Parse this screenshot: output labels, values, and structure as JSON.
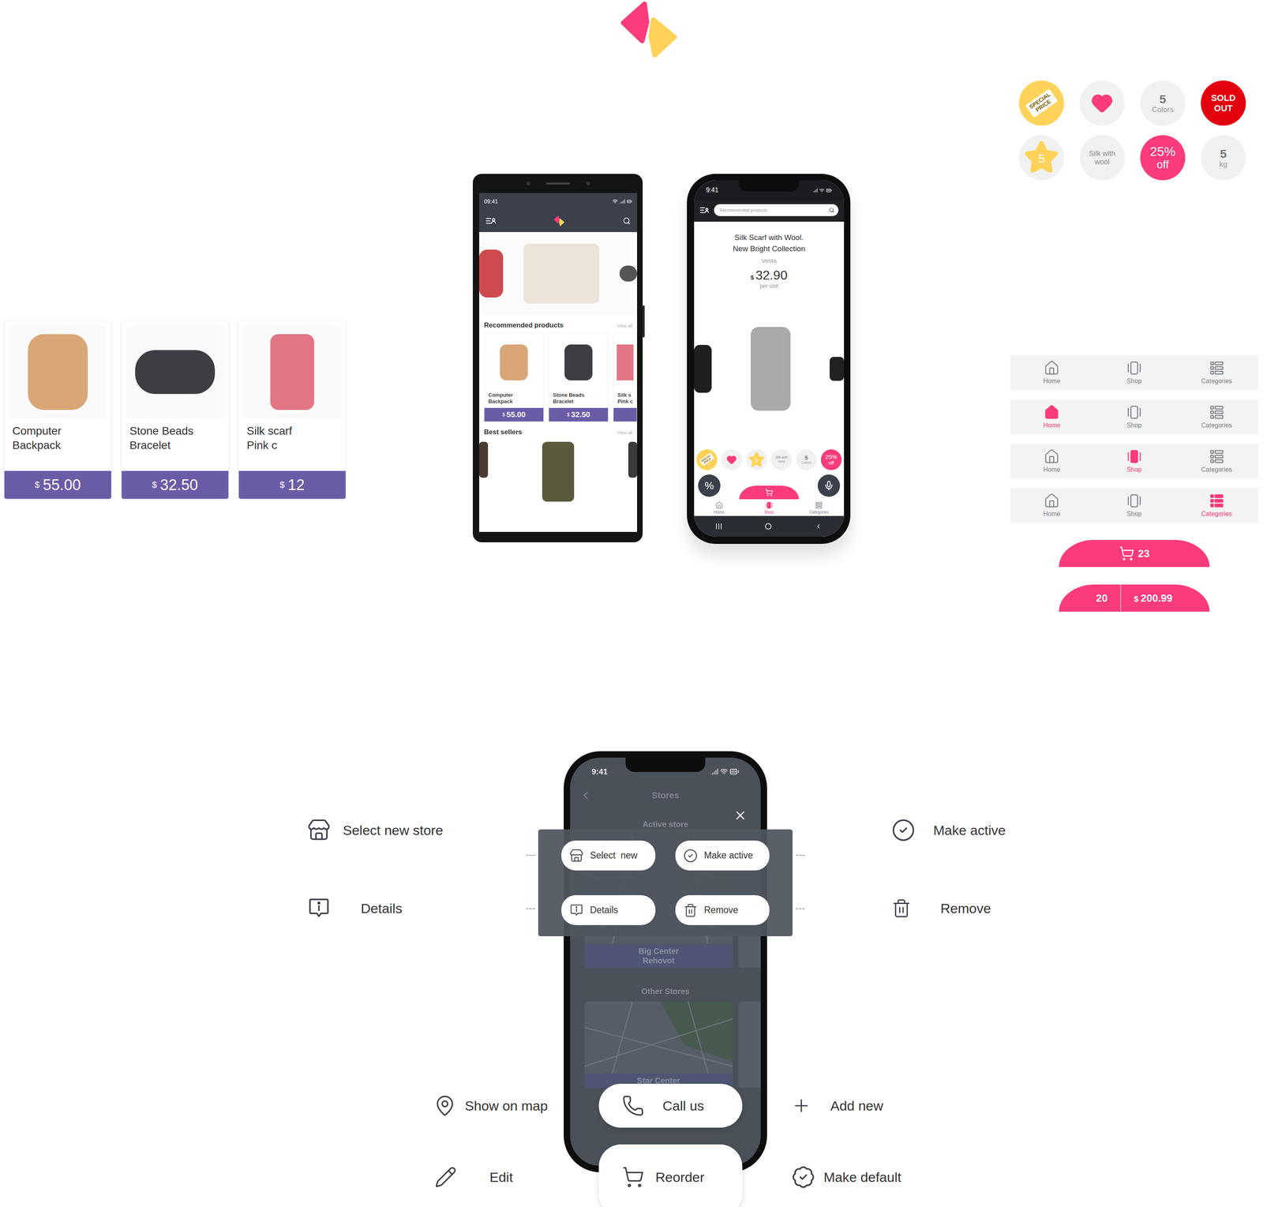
{
  "badges": [
    {
      "kind": "special",
      "text": "SPECIAL PRICE"
    },
    {
      "kind": "heart"
    },
    {
      "kind": "count",
      "value": "5",
      "label": "Colors"
    },
    {
      "kind": "sold",
      "text": "SOLD OUT"
    },
    {
      "kind": "star",
      "value": "5"
    },
    {
      "kind": "material",
      "text": "Silk with wool"
    },
    {
      "kind": "discount",
      "value": "25%",
      "label": "off"
    },
    {
      "kind": "count",
      "value": "5",
      "label": "kg"
    }
  ],
  "product_cards": [
    {
      "name_lines": [
        "Computer",
        "Backpack"
      ],
      "currency": "$",
      "price": "55.00"
    },
    {
      "name_lines": [
        "Stone Beads",
        "Bracelet"
      ],
      "currency": "$",
      "price": "32.50"
    },
    {
      "name_lines": [
        "Silk scarf",
        "Pink c"
      ],
      "currency": "$",
      "price": "12"
    }
  ],
  "android_phone": {
    "time": "09:41",
    "sections": [
      {
        "title": "Recommended products",
        "link": "View all"
      },
      {
        "title": "Best sellers",
        "link": "View all"
      }
    ],
    "products": [
      {
        "name_lines": [
          "Computer",
          "Backpack"
        ],
        "currency": "$",
        "price": "55.00"
      },
      {
        "name_lines": [
          "Stone Beads",
          "Bracelet"
        ],
        "currency": "$",
        "price": "32.50"
      },
      {
        "name_lines": [
          "Silk s",
          "Pink c"
        ]
      }
    ]
  },
  "product_phone": {
    "time": "9:41",
    "search_placeholder": "Recommended products",
    "title_lines": [
      "Silk Scarf with Wool.",
      "New Bright Collection"
    ],
    "brand": "Vesta",
    "currency": "$",
    "price": "32.90",
    "unit": "per unit",
    "badges": [
      {
        "kind": "special",
        "text": "SPECIAL PRICE"
      },
      {
        "kind": "heart"
      },
      {
        "kind": "star",
        "value": "5"
      },
      {
        "kind": "material",
        "text": "Silk with wool"
      },
      {
        "kind": "count",
        "value": "5",
        "label": "Colors"
      },
      {
        "kind": "discount",
        "value": "25%",
        "label": "off"
      }
    ],
    "discount_button": "%",
    "nav": [
      {
        "label": "Home",
        "selected": false
      },
      {
        "label": "Shop",
        "selected": true
      },
      {
        "label": "Categories",
        "selected": false
      }
    ]
  },
  "nav_variants": [
    {
      "items": [
        {
          "label": "Home",
          "selected": false
        },
        {
          "label": "Shop",
          "selected": false
        },
        {
          "label": "Categories",
          "selected": false
        }
      ]
    },
    {
      "items": [
        {
          "label": "Home",
          "selected": true
        },
        {
          "label": "Shop",
          "selected": false
        },
        {
          "label": "Categories",
          "selected": false
        }
      ]
    },
    {
      "items": [
        {
          "label": "Home",
          "selected": false
        },
        {
          "label": "Shop",
          "selected": true
        },
        {
          "label": "Categories",
          "selected": false
        }
      ]
    },
    {
      "items": [
        {
          "label": "Home",
          "selected": false
        },
        {
          "label": "Shop",
          "selected": false
        },
        {
          "label": "Categories",
          "selected": true
        }
      ]
    }
  ],
  "cart_tabs": [
    {
      "kind": "count",
      "count": "23"
    },
    {
      "kind": "total",
      "count": "20",
      "currency": "$",
      "total": "200.99"
    }
  ],
  "stores_phone": {
    "time": "9:41",
    "title": "Stores",
    "active_label": "Active store",
    "active_store": "Big Center Rehovot",
    "others_label": "Other Stores",
    "other_store": "Star Center",
    "menu": [
      {
        "label": "Select  new"
      },
      {
        "label": "Make active"
      },
      {
        "label": "Details"
      },
      {
        "label": "Remove"
      }
    ]
  },
  "legend": {
    "left": [
      {
        "label": "Select new store"
      },
      {
        "label": "Details"
      }
    ],
    "right": [
      {
        "label": "Make active"
      },
      {
        "label": "Remove"
      }
    ]
  },
  "bottom_actions": [
    {
      "left": "Show on map",
      "button": "Call us",
      "right": "Add new"
    },
    {
      "left": "Edit",
      "button": "Reorder",
      "right": "Make default"
    }
  ]
}
